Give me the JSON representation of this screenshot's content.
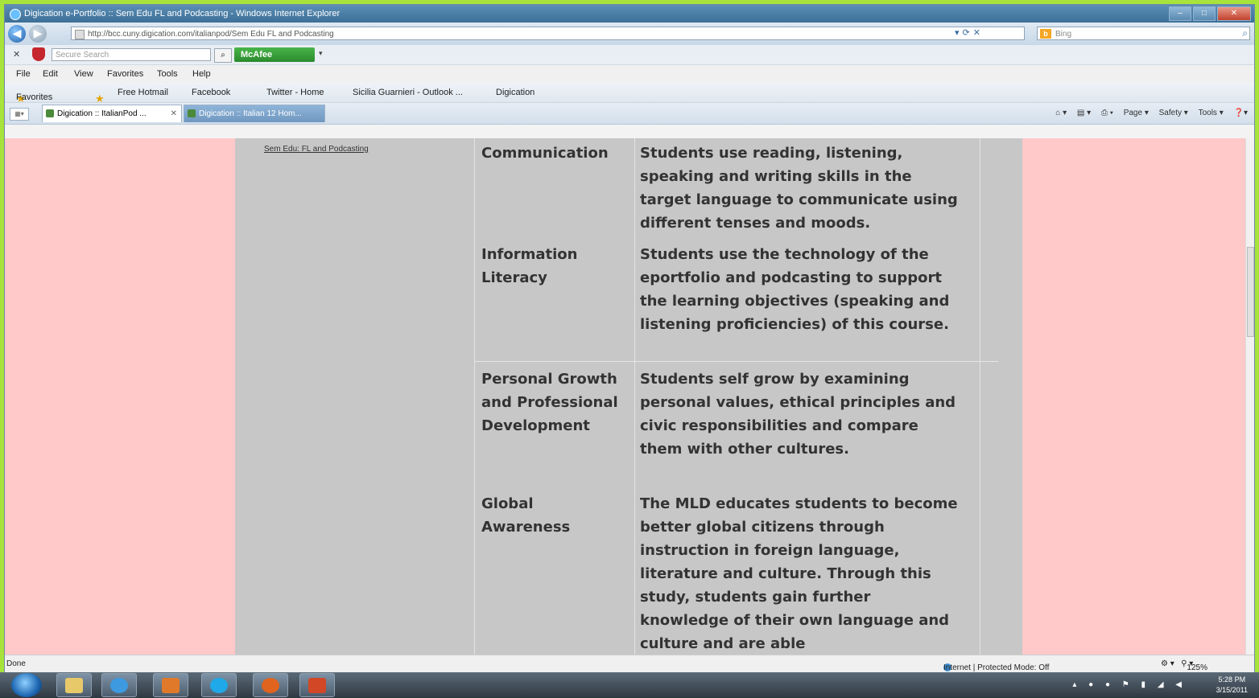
{
  "window": {
    "title": "Digication e-Portfolio :: Sem Edu FL and Podcasting - Windows Internet Explorer",
    "controls": [
      "–",
      "□",
      "✕"
    ]
  },
  "address_bar": {
    "url": "http://bcc.cuny.digication.com/italianpod/Sem Edu FL and Podcasting",
    "bing_placeholder": "Bing"
  },
  "mcafee_bar": {
    "search_placeholder": "Secure Search",
    "mcafee_label": "McAfee"
  },
  "menu": [
    "File",
    "Edit",
    "View",
    "Favorites",
    "Tools",
    "Help"
  ],
  "favorites_bar": {
    "favorites_label": "Favorites",
    "links": [
      "Free Hotmail",
      "Facebook",
      "Twitter - Home",
      "Sicilia Guarnieri - Outlook ...",
      "Digication"
    ]
  },
  "tabs": [
    {
      "label": "Digication :: ItalianPod ..."
    },
    {
      "label": "Digication :: Italian 12 Hom..."
    }
  ],
  "command_bar": [
    "Page ▾",
    "Safety ▾",
    "Tools ▾"
  ],
  "page": {
    "side_link": "Sem Edu: FL and Podcasting",
    "rows": [
      {
        "label": "Communication",
        "desc": "Students use reading, listening, speaking and writing skills in the target language to communicate using different tenses and moods."
      },
      {
        "label": "Information Literacy",
        "desc": "Students use the technology of the eportfolio and podcasting to support the learning objectives (speaking and listening proficiencies) of this course."
      },
      {
        "label": "Personal Growth and Professional Development",
        "desc": "Students self grow by examining personal values, ethical principles and civic responsibilities and compare them with other cultures."
      },
      {
        "label": "Global Awareness",
        "desc": "The MLD educates students to become better global citizens through instruction in foreign language, literature and culture. Through this study, students gain further knowledge of their own language and culture and are able"
      }
    ]
  },
  "status_bar": {
    "left": "Done",
    "zone": "Internet | Protected Mode: Off",
    "zoom": "125%"
  },
  "taskbar": {
    "clock_time": "5:28 PM",
    "clock_date": "3/15/2011"
  }
}
